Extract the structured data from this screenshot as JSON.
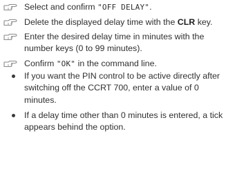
{
  "steps": [
    {
      "icon": "pointing-hand-icon",
      "pre": "Select and confirm ",
      "code": "\"OFF DELAY\"",
      "post": "."
    },
    {
      "icon": "pointing-hand-icon",
      "pre": "Delete the displayed delay time with the ",
      "key": "CLR",
      "post": " key."
    },
    {
      "icon": "pointing-hand-icon",
      "text": "Enter the desired delay time in minutes with the number keys (0 to 99 minutes)."
    },
    {
      "icon": "pointing-hand-icon",
      "pre": "Confirm ",
      "code": "\"OK\"",
      "post": " in the command line."
    }
  ],
  "notes": [
    {
      "icon": "bullet-dot",
      "text": "If you want the PIN control to be active directly after switching off the CCRT 700, enter a value of 0 minutes."
    },
    {
      "icon": "bullet-dot",
      "text": "If a delay time other than 0 minutes is entered, a tick appears behind the option."
    }
  ],
  "colors": {
    "text": "#2f2f2f",
    "icon": "#8a8a8a"
  }
}
